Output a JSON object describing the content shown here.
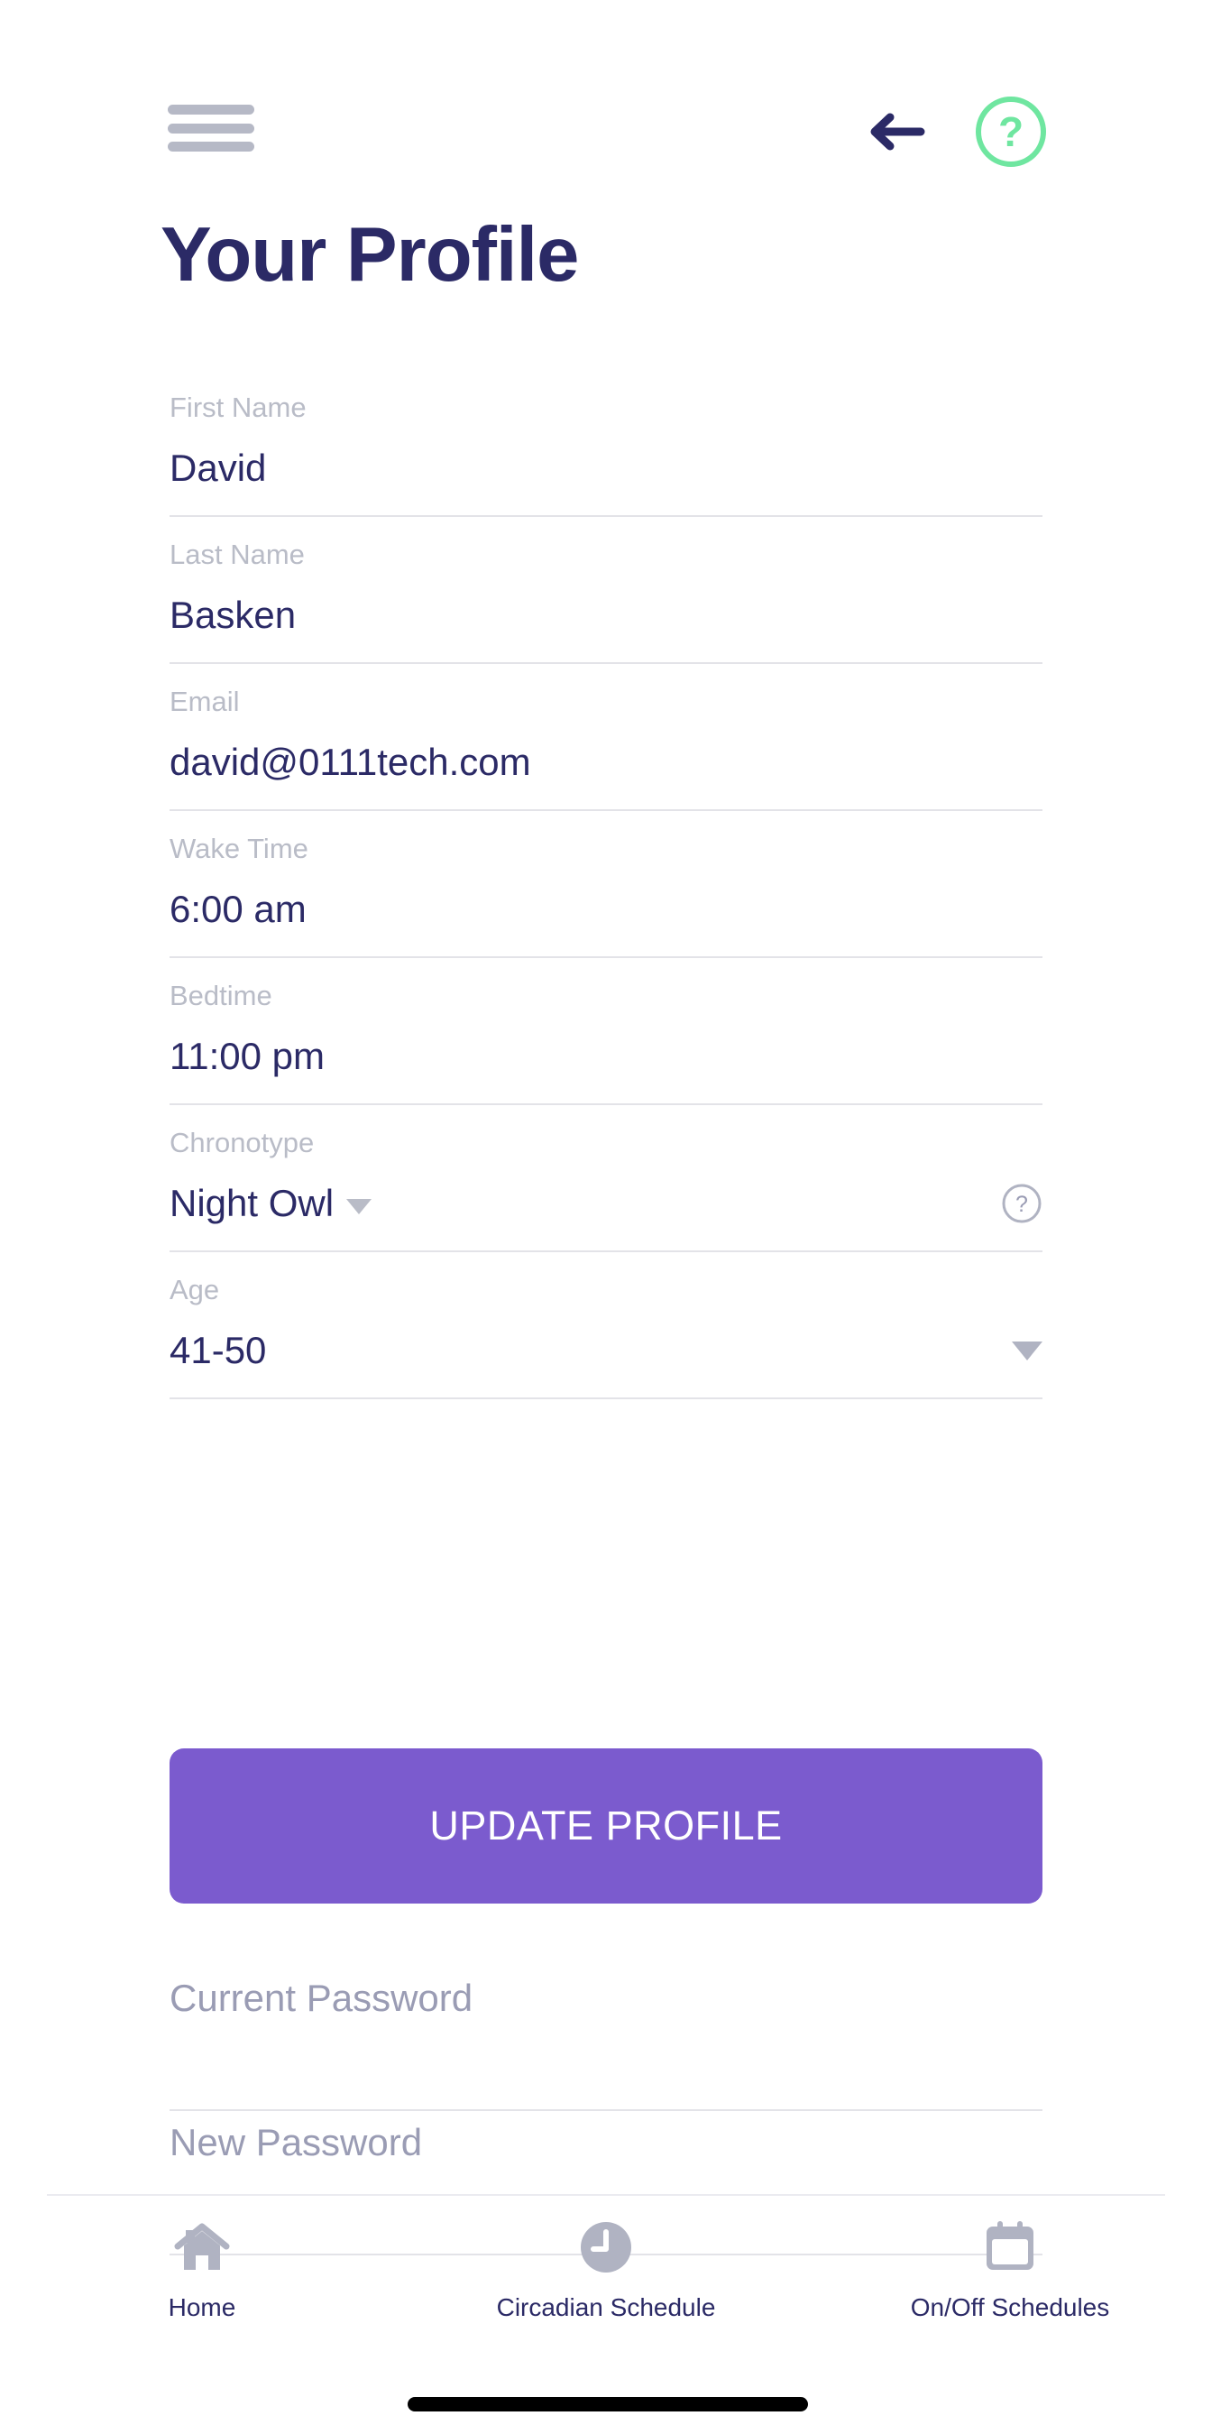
{
  "header": {
    "menu_icon": "hamburger-menu-icon",
    "back_icon": "back-arrow-icon",
    "help_icon": "help-circle-icon"
  },
  "page_title": "Your Profile",
  "form": {
    "fields": [
      {
        "label": "First Name",
        "value": "David",
        "control": "text"
      },
      {
        "label": "Last Name",
        "value": "Basken",
        "control": "text"
      },
      {
        "label": "Email",
        "value": "david@0111tech.com",
        "control": "text"
      },
      {
        "label": "Wake Time",
        "value": "6:00 am",
        "control": "text"
      },
      {
        "label": "Bedtime",
        "value": "11:00 pm",
        "control": "text"
      },
      {
        "label": "Chronotype",
        "value": "Night Owl",
        "control": "dropdown-inline",
        "help_icon": "help-circle-small-icon"
      },
      {
        "label": "Age",
        "value": "41-50",
        "control": "dropdown-right"
      }
    ]
  },
  "update_button": {
    "label": "UPDATE PROFILE",
    "color": "#7b5bce"
  },
  "passwords": [
    {
      "placeholder": "Current Password"
    },
    {
      "placeholder": "New Password"
    }
  ],
  "bottom_nav": {
    "items": [
      {
        "label": "Home",
        "icon": "home-icon"
      },
      {
        "label": "Circadian Schedule",
        "icon": "clock-icon"
      },
      {
        "label": "On/Off Schedules",
        "icon": "calendar-icon"
      }
    ]
  },
  "colors": {
    "primary_text": "#2b2a66",
    "label_gray": "#b9bcc7",
    "accent_purple": "#7b5bce",
    "accent_green": "#6fe6a0",
    "divider": "#e3e3e8"
  }
}
